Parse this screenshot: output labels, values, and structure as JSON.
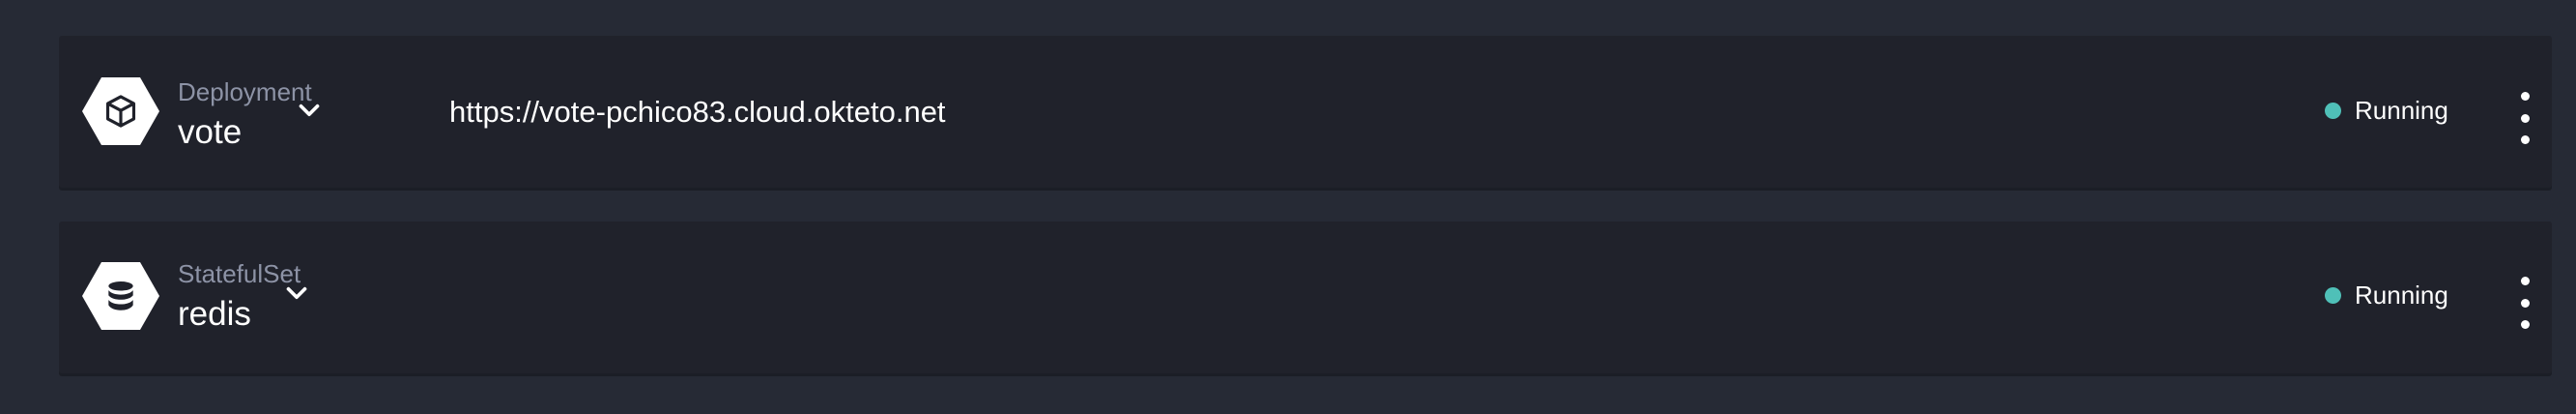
{
  "colors": {
    "page_background": "#262a35",
    "row_background": "#20222b",
    "kind_text": "#8d93a6",
    "status_running": "#4fc0b8"
  },
  "services": [
    {
      "kind": "Deployment",
      "name": "vote",
      "icon": "cube-icon",
      "endpoint": "https://vote-pchico83.cloud.okteto.net",
      "status": "Running"
    },
    {
      "kind": "StatefulSet",
      "name": "redis",
      "icon": "database-icon",
      "endpoint": "",
      "status": "Running"
    }
  ]
}
